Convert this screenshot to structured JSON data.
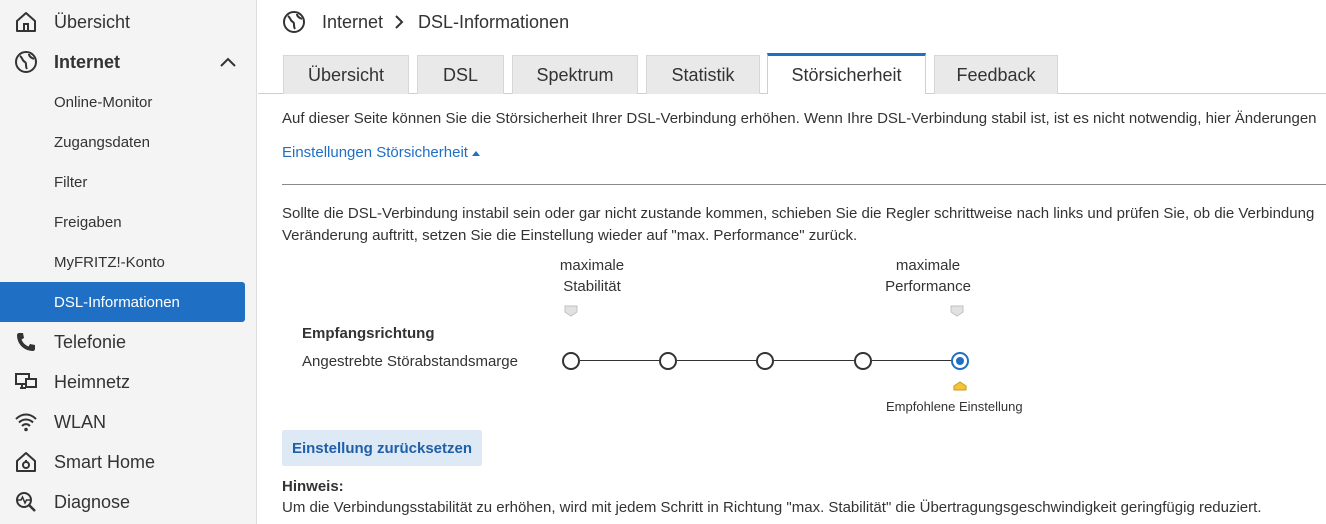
{
  "sidebar": {
    "items": [
      {
        "label": "Übersicht",
        "icon": "home-icon"
      },
      {
        "label": "Internet",
        "icon": "globe-icon"
      },
      {
        "label": "Online-Monitor"
      },
      {
        "label": "Zugangsdaten"
      },
      {
        "label": "Filter"
      },
      {
        "label": "Freigaben"
      },
      {
        "label": "MyFRITZ!-Konto"
      },
      {
        "label": "DSL-Informationen"
      },
      {
        "label": "Telefonie",
        "icon": "phone-icon"
      },
      {
        "label": "Heimnetz",
        "icon": "network-icon"
      },
      {
        "label": "WLAN",
        "icon": "wifi-icon"
      },
      {
        "label": "Smart Home",
        "icon": "smart-home-icon"
      },
      {
        "label": "Diagnose",
        "icon": "diagnose-icon"
      }
    ]
  },
  "breadcrumb": {
    "section": "Internet",
    "page": "DSL-Informationen"
  },
  "tabs": [
    "Übersicht",
    "DSL",
    "Spektrum",
    "Statistik",
    "Störsicherheit",
    "Feedback"
  ],
  "active_tab": "Störsicherheit",
  "intro": "Auf dieser Seite können Sie die Störsicherheit Ihrer DSL-Verbindung erhöhen. Wenn Ihre DSL-Verbindung stabil ist, ist es nicht notwendig, hier Änderungen",
  "settings_link": "Einstellungen Störsicherheit",
  "desc": {
    "line1": "Sollte die DSL-Verbindung instabil sein oder gar nicht zustande kommen, schieben Sie die Regler schrittweise nach links und prüfen Sie, ob die Verbindung",
    "line2": "Veränderung auftritt, setzen Sie die Einstellung wieder auf \"max. Performance\" zurück."
  },
  "slider": {
    "left_label": {
      "l1": "maximale",
      "l2": "Stabilität"
    },
    "right_label": {
      "l1": "maximale",
      "l2": "Performance"
    },
    "section_title": "Empfangsrichtung",
    "row_label": "Angestrebte Störabstandsmarge",
    "step_count": 5,
    "selected_step": 5,
    "recommended_label": "Empfohlene Einstellung"
  },
  "reset_button": "Einstellung zurücksetzen",
  "note": {
    "title": "Hinweis:",
    "text": "Um die Verbindungsstabilität zu erhöhen, wird mit jedem Schritt in Richtung \"max. Stabilität\" die Übertragungsgeschwindigkeit geringfügig reduziert."
  },
  "colors": {
    "accent": "#1f6fc4",
    "sidebar_bg": "#f4f4f4",
    "button_bg": "#ddeaf6"
  }
}
